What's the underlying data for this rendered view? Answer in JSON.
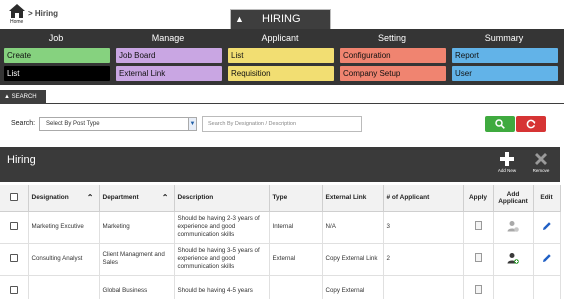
{
  "breadcrumb": {
    "home_label": "Home",
    "separator": ">",
    "current": "Hiring"
  },
  "module_tab": {
    "label": "HIRING"
  },
  "modules": [
    {
      "heading": "Job",
      "items": [
        {
          "label": "Create",
          "color": "#86d27f"
        },
        {
          "label": "List",
          "color": "#000000",
          "text_color": "#ffffff"
        }
      ]
    },
    {
      "heading": "Manage",
      "items": [
        {
          "label": "Job Board",
          "color": "#c9a6e3"
        },
        {
          "label": "External Link",
          "color": "#c9a6e3"
        }
      ]
    },
    {
      "heading": "Applicant",
      "items": [
        {
          "label": "List",
          "color": "#f2de72"
        },
        {
          "label": "Requisition",
          "color": "#f2de72"
        }
      ]
    },
    {
      "heading": "Setting",
      "items": [
        {
          "label": "Configuration",
          "color": "#f08470"
        },
        {
          "label": "Company Setup",
          "color": "#f08470"
        }
      ]
    },
    {
      "heading": "Summary",
      "items": [
        {
          "label": "Report",
          "color": "#62b3e8"
        },
        {
          "label": "User",
          "color": "#62b3e8"
        }
      ]
    }
  ],
  "search": {
    "tab_label": "SEARCH",
    "label": "Search:",
    "post_type_value": "Select By Post Type",
    "placeholder": "Search By Designation / Description"
  },
  "panel": {
    "title": "Hiring",
    "add_label": "Add New",
    "remove_label": "Remove"
  },
  "table": {
    "headers": {
      "designation": "Designation",
      "department": "Department",
      "description": "Description",
      "type": "Type",
      "external_link": "External Link",
      "applicants": "# of Applicant",
      "apply": "Apply",
      "add_applicant": "Add Applicant",
      "edit": "Edit"
    },
    "rows": [
      {
        "designation": "Marketing Excutive",
        "department": "Marketing",
        "description": "Should be having 2-3 years of experience and good communication skills",
        "type": "Internal",
        "external_link": "N/A",
        "applicants": "3"
      },
      {
        "designation": "Consulting Analyst",
        "department": "Client Managment and Sales",
        "description": "Should be having 3-5 years of experience and good communication skills",
        "type": "External",
        "external_link": "Copy External Link",
        "applicants": "2"
      },
      {
        "designation": "",
        "department": "Global Business",
        "description": "Should be having 4-5 years",
        "type": "",
        "external_link": "Copy External",
        "applicants": ""
      }
    ]
  },
  "colors": {
    "bar_dark": "#353535",
    "link": "#2471b5",
    "go": "#3faa3f",
    "reset": "#d63434"
  }
}
